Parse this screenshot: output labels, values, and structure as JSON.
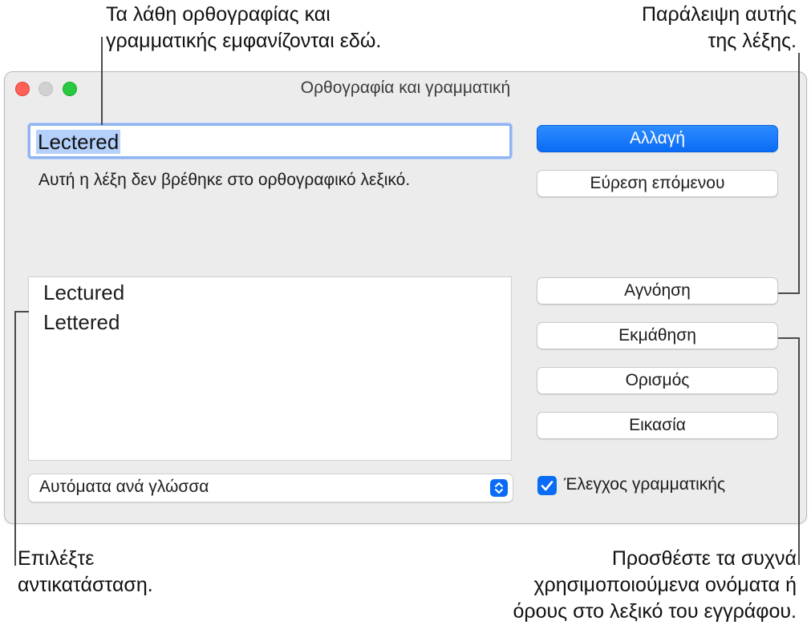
{
  "callouts": {
    "top_left": [
      "Τα λάθη ορθογραφίας και",
      "γραμματικής εμφανίζονται εδώ."
    ],
    "top_right": [
      "Παράλειψη αυτής",
      "της λέξης."
    ],
    "bottom_left": [
      "Επιλέξτε",
      "αντικατάσταση."
    ],
    "bottom_right": [
      "Προσθέστε τα συχνά",
      "χρησιμοποιούμενα ονόματα ή",
      "όρους στο λεξικό του εγγράφου."
    ]
  },
  "window": {
    "title": "Ορθογραφία και γραμματική"
  },
  "misspelled_word": "Lectered",
  "message": "Αυτή η λέξη δεν βρέθηκε στο ορθογραφικό λεξικό.",
  "suggestions": [
    "Lectured",
    "Lettered"
  ],
  "buttons": {
    "change": "Αλλαγή",
    "find_next": "Εύρεση επόμενου",
    "ignore": "Αγνόηση",
    "learn": "Εκμάθηση",
    "define": "Ορισμός",
    "guess": "Εικασία"
  },
  "language_popup": {
    "selected": "Αυτόματα ανά γλώσσα"
  },
  "grammar_check": {
    "label": "Έλεγχος γραμματικής",
    "checked": true
  },
  "colors": {
    "accent": "#0a6cf5",
    "selection": "#b5d1fb",
    "window_bg": "#ececec",
    "close": "#ff5f57",
    "maximize": "#28c840"
  }
}
